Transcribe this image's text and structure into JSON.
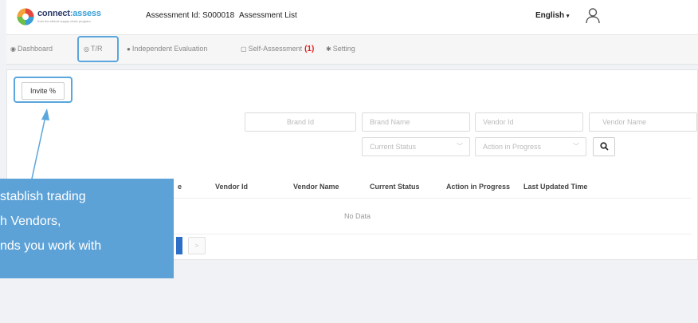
{
  "header": {
    "brand_name_part1": "connect",
    "brand_name_part2": ":assess",
    "brand_tagline": "from the ethical supply chain program",
    "assessment_id": "Assessment Id: S000018",
    "assessment_list": "Assessment List",
    "language": "English",
    "colors": {
      "brand_dark": "#2b3a67",
      "brand_accent": "#3aa0d8",
      "highlight": "#5aa6dd"
    }
  },
  "nav": {
    "dashboard": "Dashboard",
    "tr": "T/R",
    "independent_evaluation": "Independent Evaluation",
    "self_assessment": "Self-Assessment",
    "self_assessment_count": "(1)",
    "setting": "Setting"
  },
  "toolbar": {
    "invite_label": "Invite"
  },
  "filters": {
    "brand_id_placeholder": "Brand Id",
    "brand_name_placeholder": "Brand Name",
    "vendor_id_placeholder": "Vendor Id",
    "vendor_name_placeholder": "Vendor Name",
    "current_status_placeholder": "Current Status",
    "action_in_progress_placeholder": "Action in Progress"
  },
  "table": {
    "columns": [
      "e",
      "Vendor Id",
      "Vendor Name",
      "Current Status",
      "Action in Progress",
      "Last Updated Time"
    ],
    "empty_text": "No Data"
  },
  "pagination": {
    "next_label": ">"
  },
  "callout": {
    "lines": [
      "stablish trading",
      "h Vendors,",
      "nds you work with"
    ],
    "color": "#5da2d7"
  }
}
